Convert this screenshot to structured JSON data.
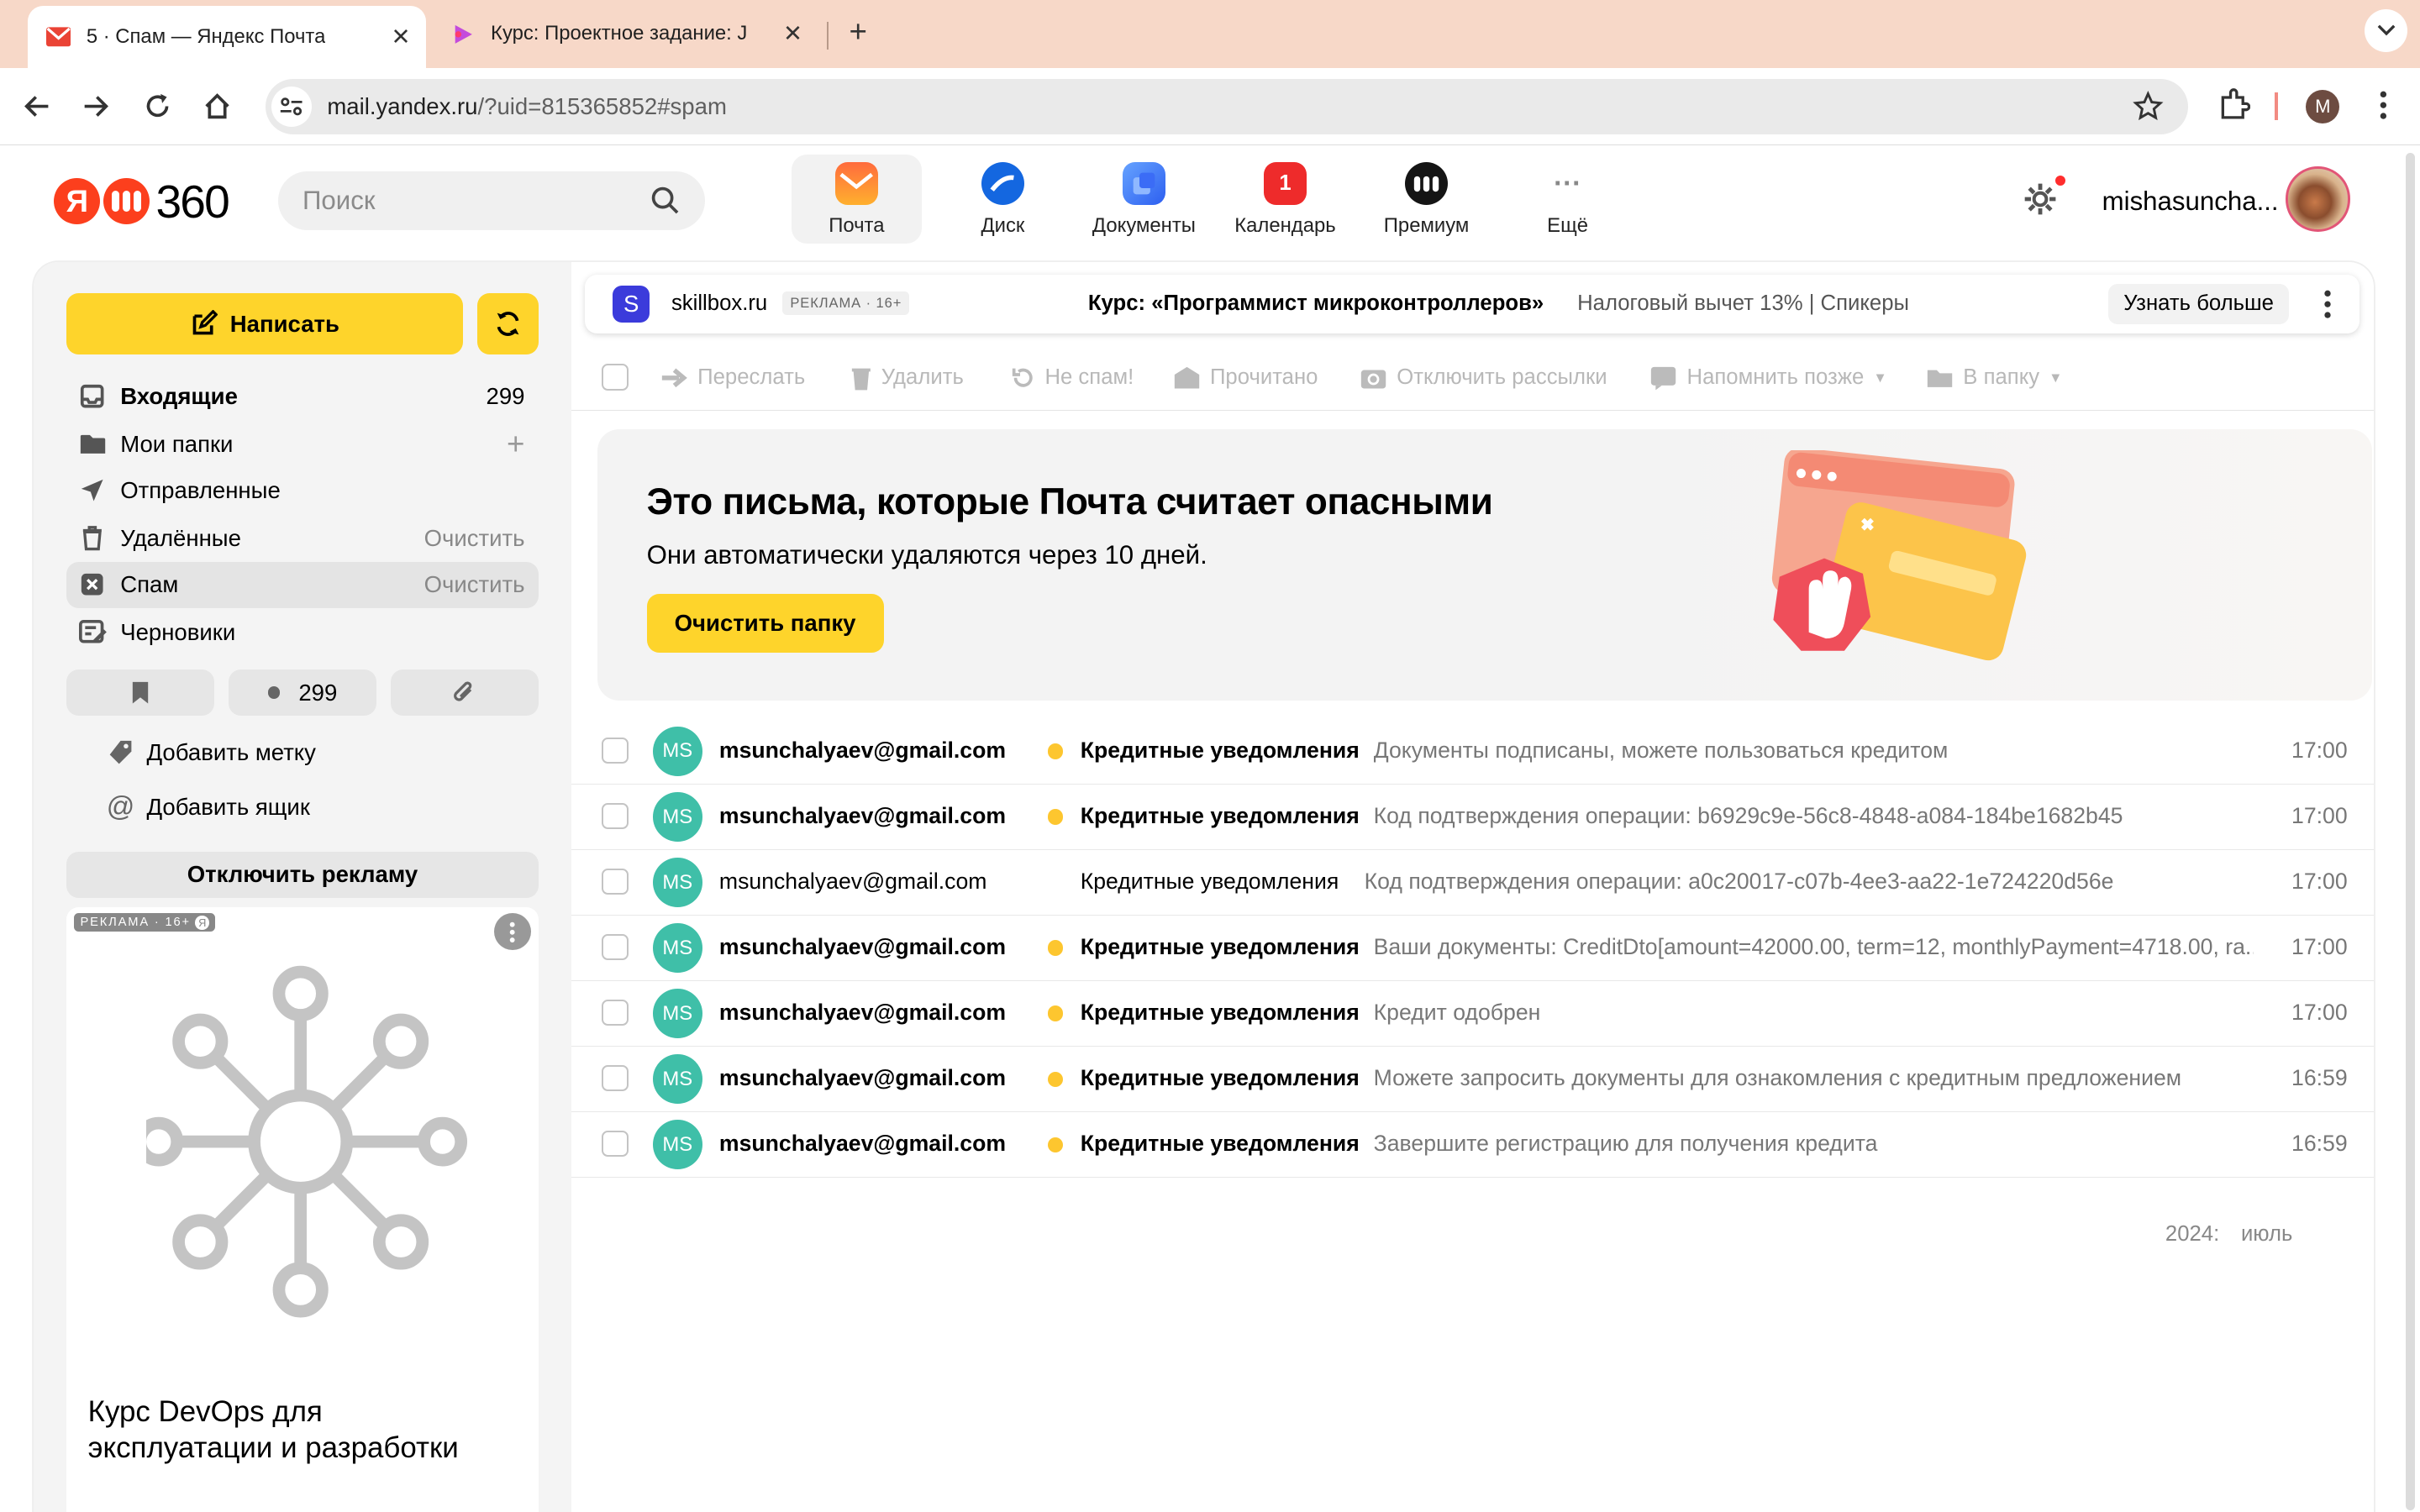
{
  "browser": {
    "tabs": [
      {
        "title": "5 · Спам — Яндекс Почта",
        "active": true
      },
      {
        "title": "Курс: Проектное задание: J",
        "active": false
      }
    ],
    "url_host": "mail.yandex.ru",
    "url_path": "/?uid=815365852#spam",
    "profile_initial": "M"
  },
  "header": {
    "logo_ya": "Я",
    "logo_num": "360",
    "search_placeholder": "Поиск",
    "apps": [
      {
        "label": "Почта",
        "color": "#ff9a1f"
      },
      {
        "label": "Диск",
        "color": "#1a73e8"
      },
      {
        "label": "Документы",
        "color": "#4a7cf4"
      },
      {
        "label": "Календарь",
        "color": "#ee2b2b",
        "badge": "1"
      },
      {
        "label": "Премиум",
        "color": "#1a1a1a"
      },
      {
        "label": "Ещё",
        "color": "#ffffff"
      }
    ],
    "username": "mishasuncha..."
  },
  "sidebar": {
    "compose_label": "Написать",
    "folders": [
      {
        "name": "Входящие",
        "count": "299",
        "icon": "inbox-icon"
      },
      {
        "name": "Мои папки",
        "action": "+",
        "icon": "folder-icon"
      },
      {
        "name": "Отправленные",
        "icon": "sent-icon"
      },
      {
        "name": "Удалённые",
        "action": "Очистить",
        "icon": "trash-icon"
      },
      {
        "name": "Спам",
        "action": "Очистить",
        "icon": "spam-icon"
      },
      {
        "name": "Черновики",
        "icon": "drafts-icon"
      }
    ],
    "unread_count": "299",
    "add_label": "Добавить метку",
    "add_mailbox": "Добавить ящик",
    "disable_ads": "Отключить рекламу",
    "ad_badge": "РЕКЛАМА · 16+",
    "ad_title": "Курс DevOps для эксплуатации и разработки"
  },
  "ad_strip": {
    "logo_letter": "S",
    "site": "skillbox.ru",
    "badge": "РЕКЛАМА · 16+",
    "headline": "Курс: «Программист микроконтроллеров»",
    "desc": "Налоговый вычет 13% | Спикеры",
    "cta": "Узнать больше"
  },
  "actions": [
    "Переслать",
    "Удалить",
    "Не спам!",
    "Прочитано",
    "Отключить рассылки",
    "Напомнить позже",
    "В папку"
  ],
  "banner": {
    "title": "Это письма, которые Почта считает опасными",
    "subtitle": "Они автоматически удаляются через 10 дней.",
    "button": "Очистить папку"
  },
  "messages": [
    {
      "initials": "MS",
      "from": "msunchalyaev@gmail.com",
      "subject": "Кредитные уведомления",
      "preview": "Документы подписаны, можете пользоваться кредитом",
      "time": "17:00",
      "unread": true
    },
    {
      "initials": "MS",
      "from": "msunchalyaev@gmail.com",
      "subject": "Кредитные уведомления",
      "preview": "Код подтверждения операции: b6929c9e-56c8-4848-a084-184be1682b45",
      "time": "17:00",
      "unread": true
    },
    {
      "initials": "MS",
      "from": "msunchalyaev@gmail.com",
      "subject": "Кредитные уведомления",
      "preview": "Код подтверждения операции: a0c20017-c07b-4ee3-aa22-1e724220d56e",
      "time": "17:00",
      "unread": false
    },
    {
      "initials": "MS",
      "from": "msunchalyaev@gmail.com",
      "subject": "Кредитные уведомления",
      "preview": "Ваши документы: CreditDto[amount=42000.00, term=12, monthlyPayment=4718.00, ra...",
      "time": "17:00",
      "unread": true
    },
    {
      "initials": "MS",
      "from": "msunchalyaev@gmail.com",
      "subject": "Кредитные уведомления",
      "preview": "Кредит одобрен",
      "time": "17:00",
      "unread": true
    },
    {
      "initials": "MS",
      "from": "msunchalyaev@gmail.com",
      "subject": "Кредитные уведомления",
      "preview": "Можете запросить документы для ознакомления с кредитным предложением",
      "time": "16:59",
      "unread": true
    },
    {
      "initials": "MS",
      "from": "msunchalyaev@gmail.com",
      "subject": "Кредитные уведомления",
      "preview": "Завершите регистрацию для получения кредита",
      "time": "16:59",
      "unread": true
    }
  ],
  "date_footer": {
    "year": "2024:",
    "month": "июль"
  }
}
